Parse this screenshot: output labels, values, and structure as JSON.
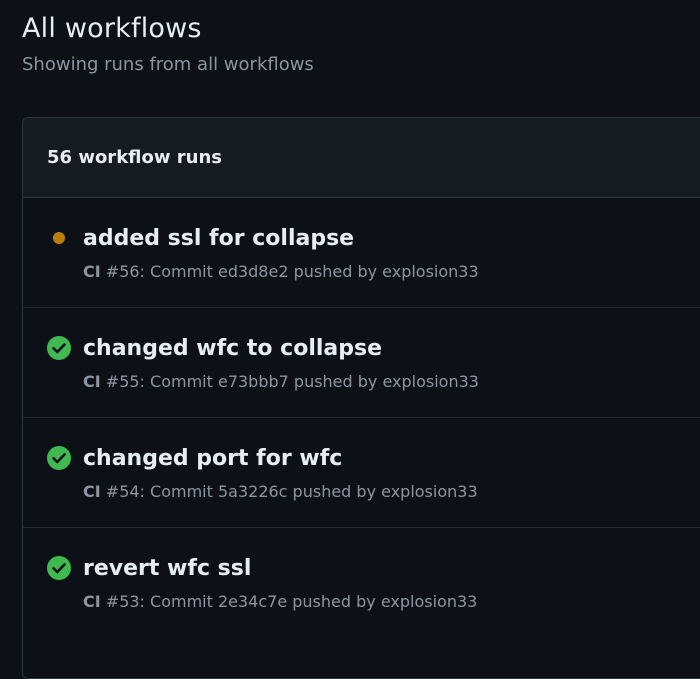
{
  "header": {
    "title": "All workflows",
    "subtitle": "Showing runs from all workflows"
  },
  "runs_box": {
    "count_label": "56 workflow runs"
  },
  "runs": [
    {
      "title": "added ssl for collapse",
      "status": "in-progress",
      "status_icon": "in-progress-dot-icon",
      "status_color": "#bb8009",
      "workflow": "CI",
      "detail": " #56: Commit ed3d8e2 pushed by explosion33"
    },
    {
      "title": "changed wfc to collapse",
      "status": "success",
      "status_icon": "check-circle-icon",
      "status_color": "#3fb950",
      "workflow": "CI",
      "detail": " #55: Commit e73bbb7 pushed by explosion33"
    },
    {
      "title": "changed port for wfc",
      "status": "success",
      "status_icon": "check-circle-icon",
      "status_color": "#3fb950",
      "workflow": "CI",
      "detail": " #54: Commit 5a3226c pushed by explosion33"
    },
    {
      "title": "revert wfc ssl",
      "status": "success",
      "status_icon": "check-circle-icon",
      "status_color": "#3fb950",
      "workflow": "CI",
      "detail": " #53: Commit 2e34c7e pushed by explosion33"
    }
  ]
}
